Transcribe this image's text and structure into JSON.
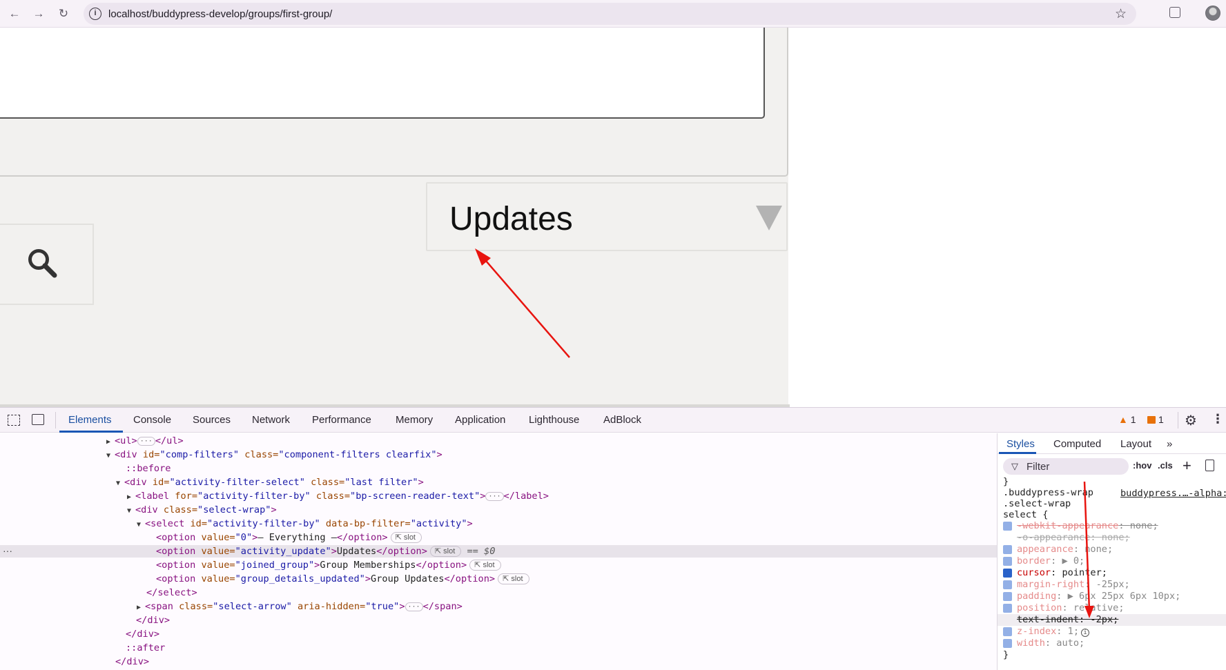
{
  "browser": {
    "url": "localhost/buddypress-develop/groups/first-group/"
  },
  "page": {
    "select_value": "Updates"
  },
  "devtools": {
    "tabs": [
      "Elements",
      "Console",
      "Sources",
      "Network",
      "Performance",
      "Memory",
      "Application",
      "Lighthouse",
      "AdBlock"
    ],
    "warnings_count": "1",
    "issues_count": "1",
    "elements": {
      "ul_open": "<ul>",
      "ul_close": "</ul>",
      "comp_filters_tag": "<div",
      "comp_filters_id_attr": " id=",
      "comp_filters_id_val": "\"comp-filters\"",
      "comp_filters_class_attr": " class=",
      "comp_filters_class_val": "\"component-filters clearfix\"",
      "before": "::before",
      "afs_id_val": "\"activity-filter-select\"",
      "afs_class_val": "\"last filter\"",
      "label_for_val": "\"activity-filter-by\"",
      "label_class_val": "\"bp-screen-reader-text\"",
      "select_wrap_class_val": "\"select-wrap\"",
      "select_id_val": "\"activity-filter-by\"",
      "select_data_attr": " data-bp-filter=",
      "select_data_val": "\"activity\"",
      "options": [
        {
          "value": "\"0\"",
          "text": "— Everything —"
        },
        {
          "value": "\"activity_update\"",
          "text": "Updates"
        },
        {
          "value": "\"joined_group\"",
          "text": "Group Memberships"
        },
        {
          "value": "\"group_details_updated\"",
          "text": "Group Updates"
        }
      ],
      "slot_label": "slot",
      "selected_marker": "== $0",
      "select_close": "</select>",
      "span_class_val": "\"select-arrow\"",
      "span_aria_attr": " aria-hidden=",
      "span_aria_val": "\"true\"",
      "div_close": "</div>",
      "after": "::after"
    },
    "styles_pane": {
      "tabs": [
        "Styles",
        "Computed",
        "Layout"
      ],
      "filter_placeholder": "Filter",
      "hov": ":hov",
      "cls": ".cls",
      "selector_line1": ".buddypress-wrap",
      "selector_line2": ".select-wrap",
      "selector_line3": "select {",
      "source": "buddypress.…-alpha:",
      "rules": [
        {
          "prop": "-webkit-appearance",
          "value": "none;",
          "state": "struck"
        },
        {
          "prop": "-o-appearance",
          "value": "none;",
          "state": "invalid"
        },
        {
          "prop": "appearance",
          "value": "none;",
          "state": "normal"
        },
        {
          "prop": "border",
          "value": "0;",
          "state": "normal"
        },
        {
          "prop": "cursor",
          "value": "pointer;",
          "state": "normal"
        },
        {
          "prop": "margin-right",
          "value": "-25px;",
          "state": "normal"
        },
        {
          "prop": "padding",
          "value": "6px 25px 6px 10px;",
          "state": "normal"
        },
        {
          "prop": "position",
          "value": "relative;",
          "state": "normal"
        },
        {
          "prop": "text-indent",
          "value": "-2px;",
          "state": "disabled"
        },
        {
          "prop": "z-index",
          "value": "1;",
          "state": "normal"
        },
        {
          "prop": "width",
          "value": "auto;",
          "state": "normal"
        }
      ],
      "close_brace": "}",
      "open_brace_top": "}"
    }
  },
  "colors": {
    "annotation_arrow": "#e8140f",
    "accent_blue": "#1a56b5",
    "warning_orange": "#e8710a"
  }
}
